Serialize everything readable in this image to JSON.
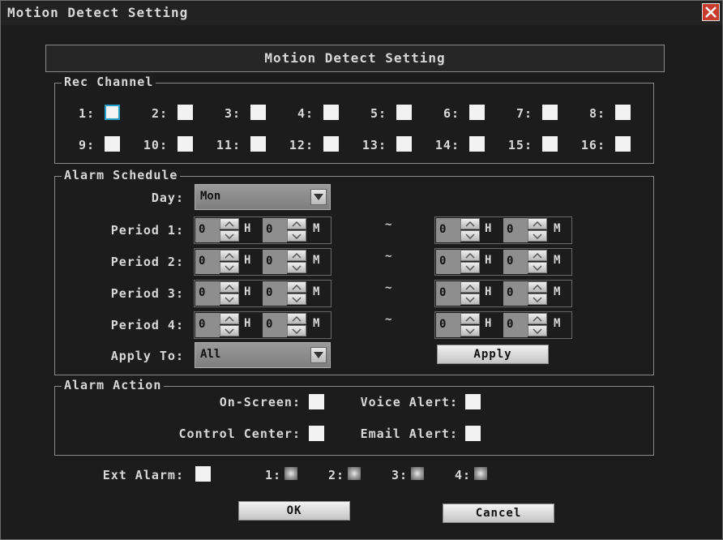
{
  "window": {
    "title": "Motion Detect Setting"
  },
  "header": {
    "title": "Motion Detect Setting"
  },
  "rec_channel": {
    "title": "Rec Channel",
    "channels": [
      "1:",
      "2:",
      "3:",
      "4:",
      "5:",
      "6:",
      "7:",
      "8:",
      "9:",
      "10:",
      "11:",
      "12:",
      "13:",
      "14:",
      "15:",
      "16:"
    ]
  },
  "alarm_schedule": {
    "title": "Alarm Schedule",
    "day_label": "Day:",
    "day_value": "Mon",
    "periods": [
      {
        "label": "Period 1:",
        "start_h": "0",
        "start_m": "0",
        "end_h": "0",
        "end_m": "0"
      },
      {
        "label": "Period 2:",
        "start_h": "0",
        "start_m": "0",
        "end_h": "0",
        "end_m": "0"
      },
      {
        "label": "Period 3:",
        "start_h": "0",
        "start_m": "0",
        "end_h": "0",
        "end_m": "0"
      },
      {
        "label": "Period 4:",
        "start_h": "0",
        "start_m": "0",
        "end_h": "0",
        "end_m": "0"
      }
    ],
    "hour_unit": "H",
    "minute_unit": "M",
    "separator": "~",
    "apply_to_label": "Apply To:",
    "apply_to_value": "All",
    "apply_button": "Apply"
  },
  "alarm_action": {
    "title": "Alarm Action",
    "on_screen": "On-Screen:",
    "voice_alert": "Voice Alert:",
    "control_center": "Control Center:",
    "email_alert": "Email Alert:"
  },
  "ext_alarm": {
    "label": "Ext Alarm:",
    "outputs": [
      "1:",
      "2:",
      "3:",
      "4:"
    ]
  },
  "footer": {
    "ok": "OK",
    "cancel": "Cancel"
  },
  "icons": {
    "close": "close-icon",
    "dropdown": "chevron-down-icon",
    "spin_up": "arrow-up-icon",
    "spin_down": "arrow-down-icon"
  },
  "colors": {
    "background": "#1c1c1c",
    "checkbox": "#f2f2f2",
    "focus": "#2aa0c8",
    "close": "#c83a2a"
  }
}
